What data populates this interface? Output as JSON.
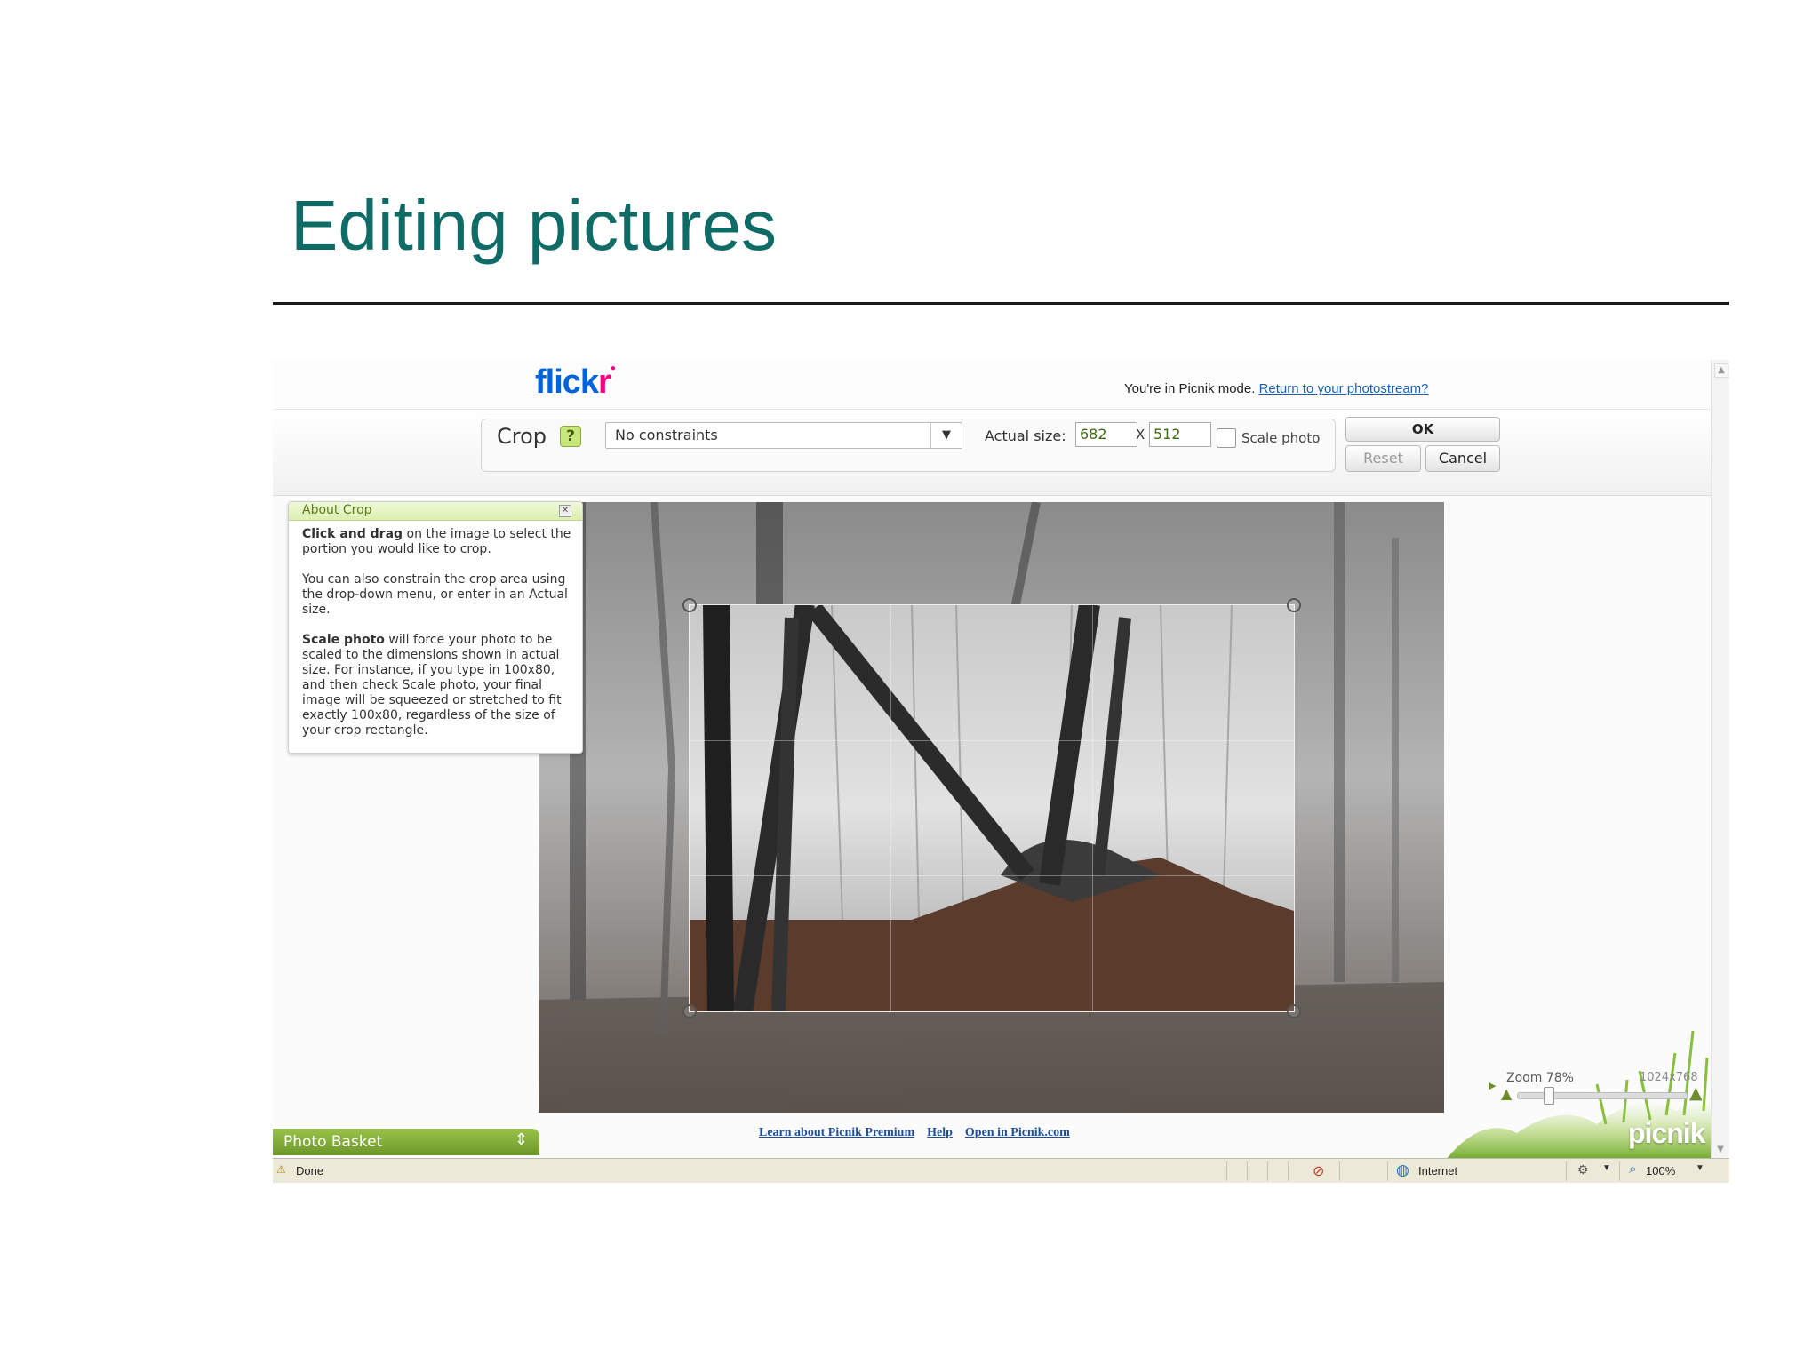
{
  "slide": {
    "title": "Editing pictures"
  },
  "flickr": {
    "logo_blue": "flick",
    "logo_pink": "r",
    "mode_text": "You're in Picnik mode.",
    "mode_link": "Return to your photostream?"
  },
  "toolbar": {
    "tool_name": "Crop",
    "help_label": "?",
    "constraint_value": "No constraints",
    "actual_size_label": "Actual size:",
    "width_value": "682",
    "separator": "X",
    "height_value": "512",
    "scale_label": "Scale photo",
    "scale_checked": false,
    "ok_label": "OK",
    "reset_label": "Reset",
    "cancel_label": "Cancel"
  },
  "about": {
    "title": "About Crop",
    "p1_bold": "Click and drag",
    "p1_rest": " on the image to select the portion you would like to crop.",
    "p2": "You can also constrain the crop area using the drop-down menu, or enter in an Actual size.",
    "p3_bold": "Scale photo",
    "p3_rest": " will force your photo to be scaled to the dimensions shown in actual size. For instance, if you type in 100x80, and then check Scale photo, your final image will be squeezed or stretched to fit exactly 100x80, regardless of the size of your crop rectangle."
  },
  "zoom": {
    "label": "Zoom 78%",
    "dimensions": "1024x768",
    "level": 0.78
  },
  "branding": {
    "picnik_logo": "picnik"
  },
  "basket": {
    "label": "Photo Basket"
  },
  "footer": {
    "links": [
      "Learn about Picnik Premium",
      "Help",
      "Open in Picnik.com"
    ]
  },
  "statusbar": {
    "status": "Done",
    "zone": "Internet",
    "zoom": "100%"
  },
  "colors": {
    "title": "#0f6b66",
    "accent_green": "#8ab43c",
    "flickr_blue": "#0063dc",
    "flickr_pink": "#ff0084",
    "link": "#1a5fb4"
  },
  "icons": [
    "help-icon",
    "chevron-down-icon",
    "close-icon",
    "zoom-out-icon",
    "zoom-in-icon",
    "play-icon",
    "updown-icon",
    "warning-icon",
    "security-icon",
    "globe-icon",
    "tools-icon",
    "magnifier-icon"
  ]
}
